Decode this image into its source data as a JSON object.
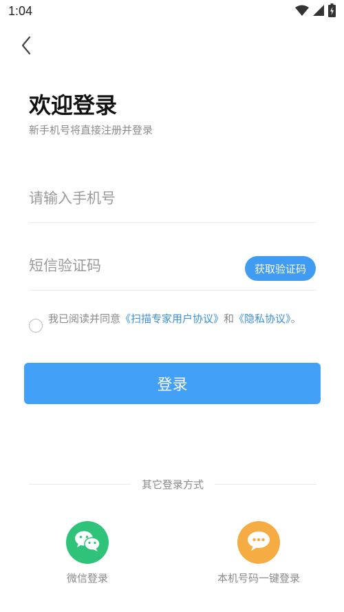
{
  "status_bar": {
    "time": "1:04"
  },
  "header": {
    "title": "欢迎登录",
    "subtitle": "新手机号将直接注册并登录"
  },
  "form": {
    "phone_placeholder": "请输入手机号",
    "code_placeholder": "短信验证码",
    "get_code_label": "获取验证码"
  },
  "agreement": {
    "prefix": "我已阅读并同意",
    "user_agreement": "《扫描专家用户协议》",
    "and": "和",
    "privacy_policy": "《隐私协议》",
    "suffix": "。",
    "checked": false
  },
  "login_button": "登录",
  "other_login": {
    "divider_label": "其它登录方式",
    "wechat_label": "微信登录",
    "onekey_label": "本机号码一键登录"
  },
  "colors": {
    "primary": "#42a0f6",
    "link": "#3b8fe0",
    "wechat": "#2fc37a",
    "onekey": "#f4ac43"
  },
  "icons": [
    "wifi-icon",
    "signal-icon",
    "battery-charging-icon",
    "back-arrow-icon",
    "wechat-icon",
    "chat-bubble-icon"
  ]
}
